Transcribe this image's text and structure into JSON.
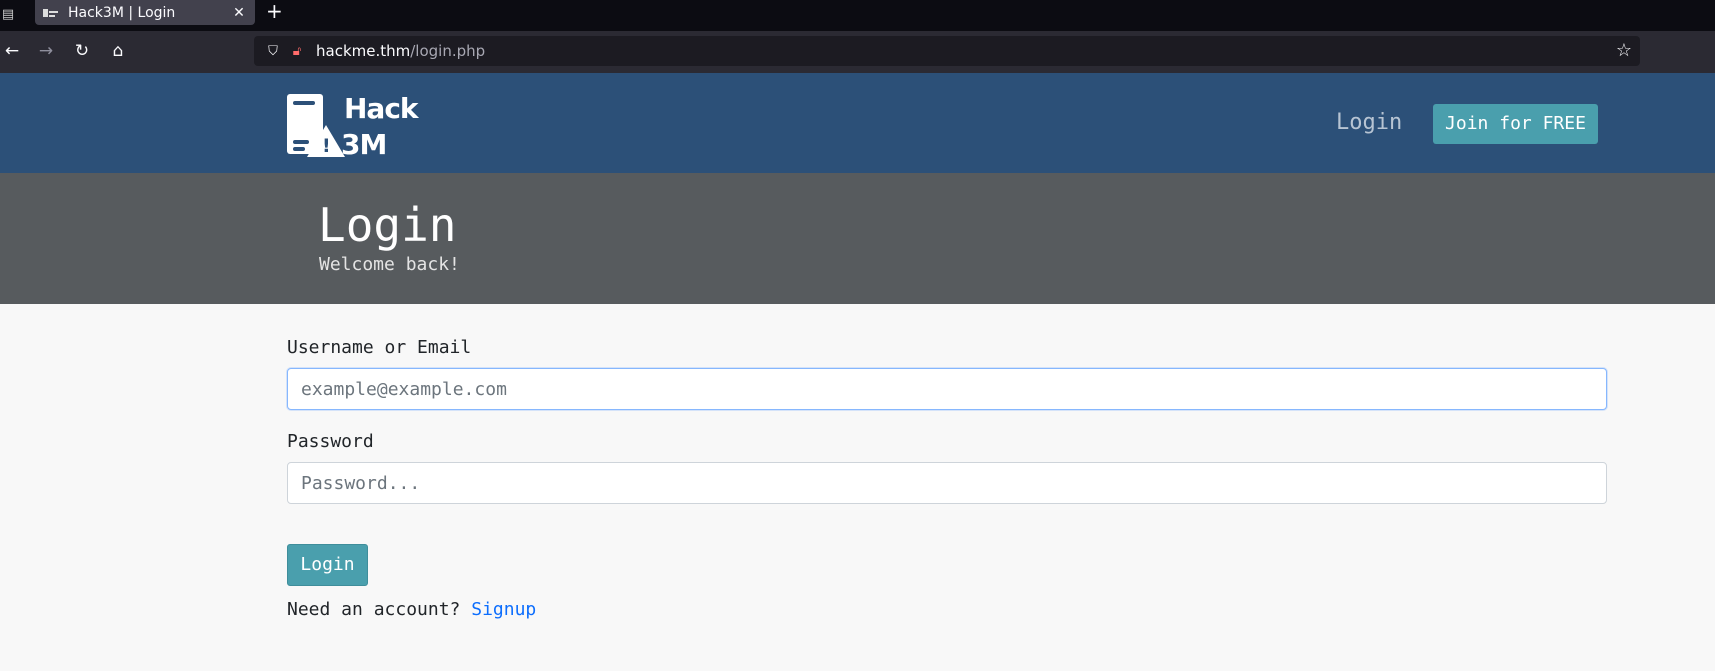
{
  "browser": {
    "tab_title": "Hack3M | Login",
    "close_glyph": "✕",
    "new_tab_glyph": "+",
    "url_host": "hackme.thm",
    "url_path": "/login.php"
  },
  "site": {
    "logo_line1": "Hack",
    "logo_line2": "3M",
    "nav_login": "Login",
    "nav_join": "Join for FREE",
    "brand_color": "#2c5078",
    "accent_color": "#4a9fad"
  },
  "banner": {
    "title": "Login",
    "subtitle": "Welcome back!"
  },
  "form": {
    "username_label": "Username or Email",
    "username_placeholder": "example@example.com",
    "username_value": "",
    "password_label": "Password",
    "password_placeholder": "Password...",
    "password_value": "",
    "submit_label": "Login",
    "account_prompt": "Need an account?",
    "signup_link": "Signup"
  },
  "icons": [
    "tab-list-icon",
    "favicon-icon",
    "close-tab-icon",
    "new-tab-icon",
    "back-icon",
    "forward-icon",
    "reload-icon",
    "home-icon",
    "shield-icon",
    "lock-icon",
    "bookmark-star-icon",
    "server-icon",
    "warning-icon"
  ]
}
